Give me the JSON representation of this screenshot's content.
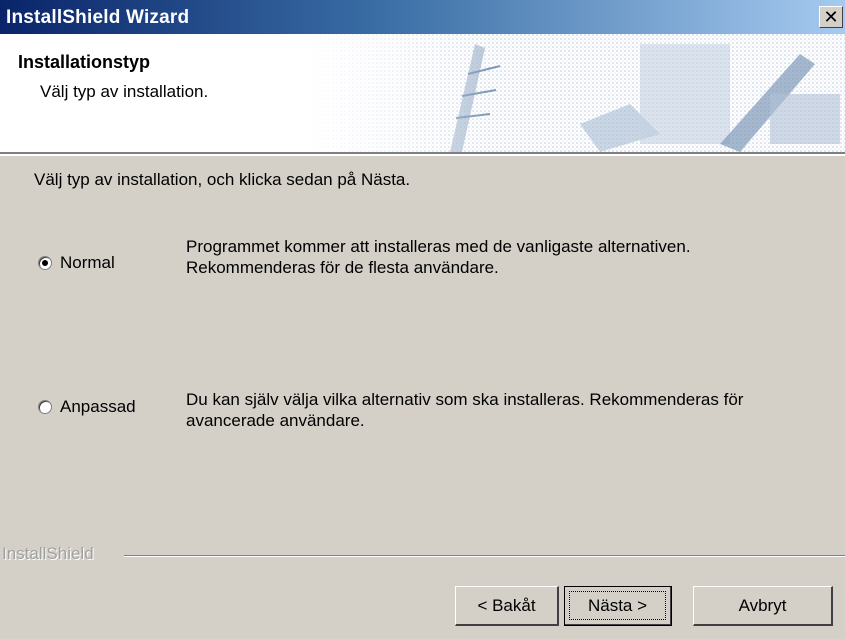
{
  "window": {
    "title": "InstallShield Wizard",
    "close_glyph": "✕"
  },
  "header": {
    "title": "Installationstyp",
    "subtitle": "Välj typ av installation."
  },
  "main": {
    "instruction": "Välj typ av installation, och klicka sedan på Nästa.",
    "options": [
      {
        "label": "Normal",
        "selected": true,
        "description_line1": "Programmet kommer att installeras med de  vanligaste alternativen.",
        "description_line2": "Rekommenderas för de flesta  användare."
      },
      {
        "label": "Anpassad",
        "selected": false,
        "description_line1": "Du kan själv välja vilka alternativ som ska  installeras. Rekommenderas för",
        "description_line2": "avancerade användare."
      }
    ]
  },
  "footer": {
    "brand": "InstallShield",
    "back_label": "< Bakåt",
    "next_label": "Nästa >",
    "cancel_label": "Avbryt"
  },
  "colors": {
    "titlebar_start": "#0a246a",
    "titlebar_end": "#a6caf0",
    "face": "#d4d0c8"
  }
}
